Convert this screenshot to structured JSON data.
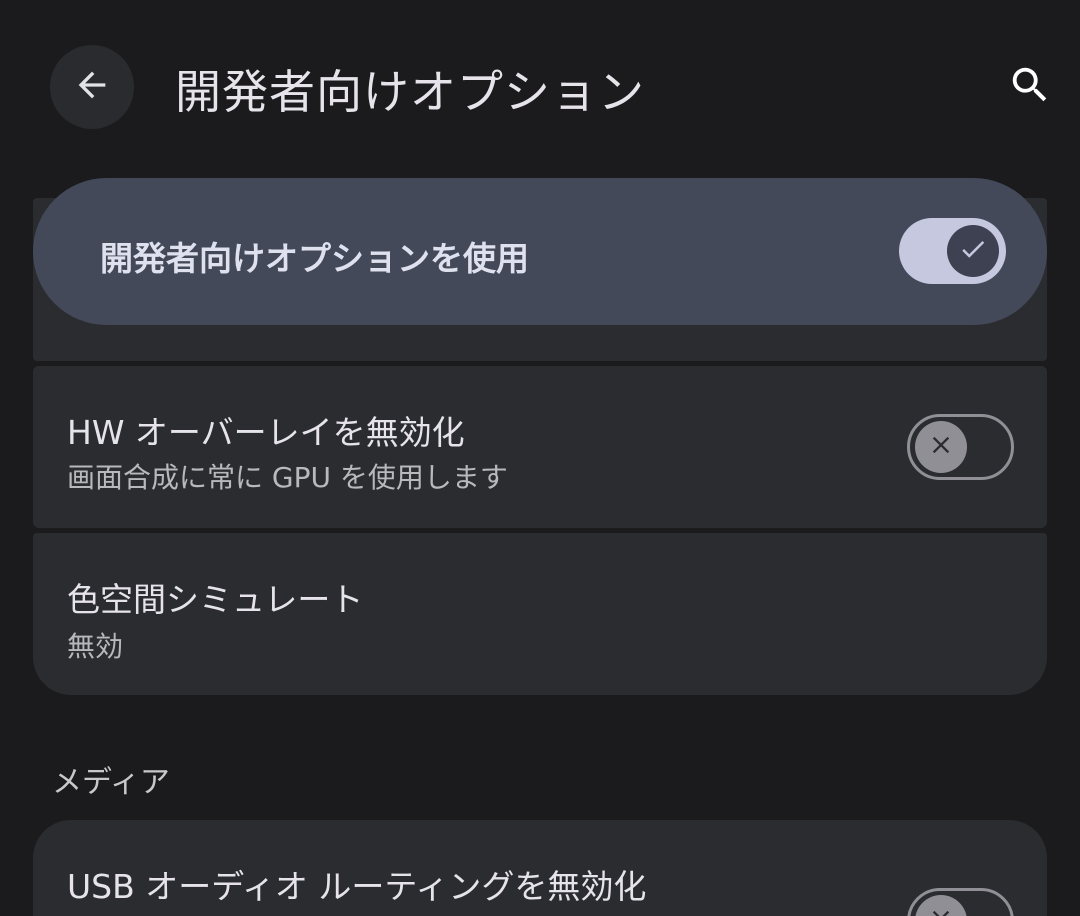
{
  "app_bar": {
    "title": "開発者向けオプション",
    "back_icon": "arrow-back-icon",
    "search_icon": "search-icon"
  },
  "main_switch": {
    "label": "開発者向けオプションを使用",
    "state": "on"
  },
  "settings": {
    "hw_overlay": {
      "title": "HW オーバーレイを無効化",
      "summary": "画面合成に常に GPU を使用します",
      "state": "off"
    },
    "color_space": {
      "title": "色空間シミュレート",
      "summary": "無効"
    }
  },
  "media_section": {
    "header": "メディア",
    "usb_audio": {
      "title": "USB オーディオ ルーティングを無効化",
      "state": "off"
    }
  },
  "colors": {
    "background": "#1b1b1d",
    "card": "#2b2c2f",
    "accent_bar": "#434959",
    "toggle_on": "#c5c8de"
  }
}
